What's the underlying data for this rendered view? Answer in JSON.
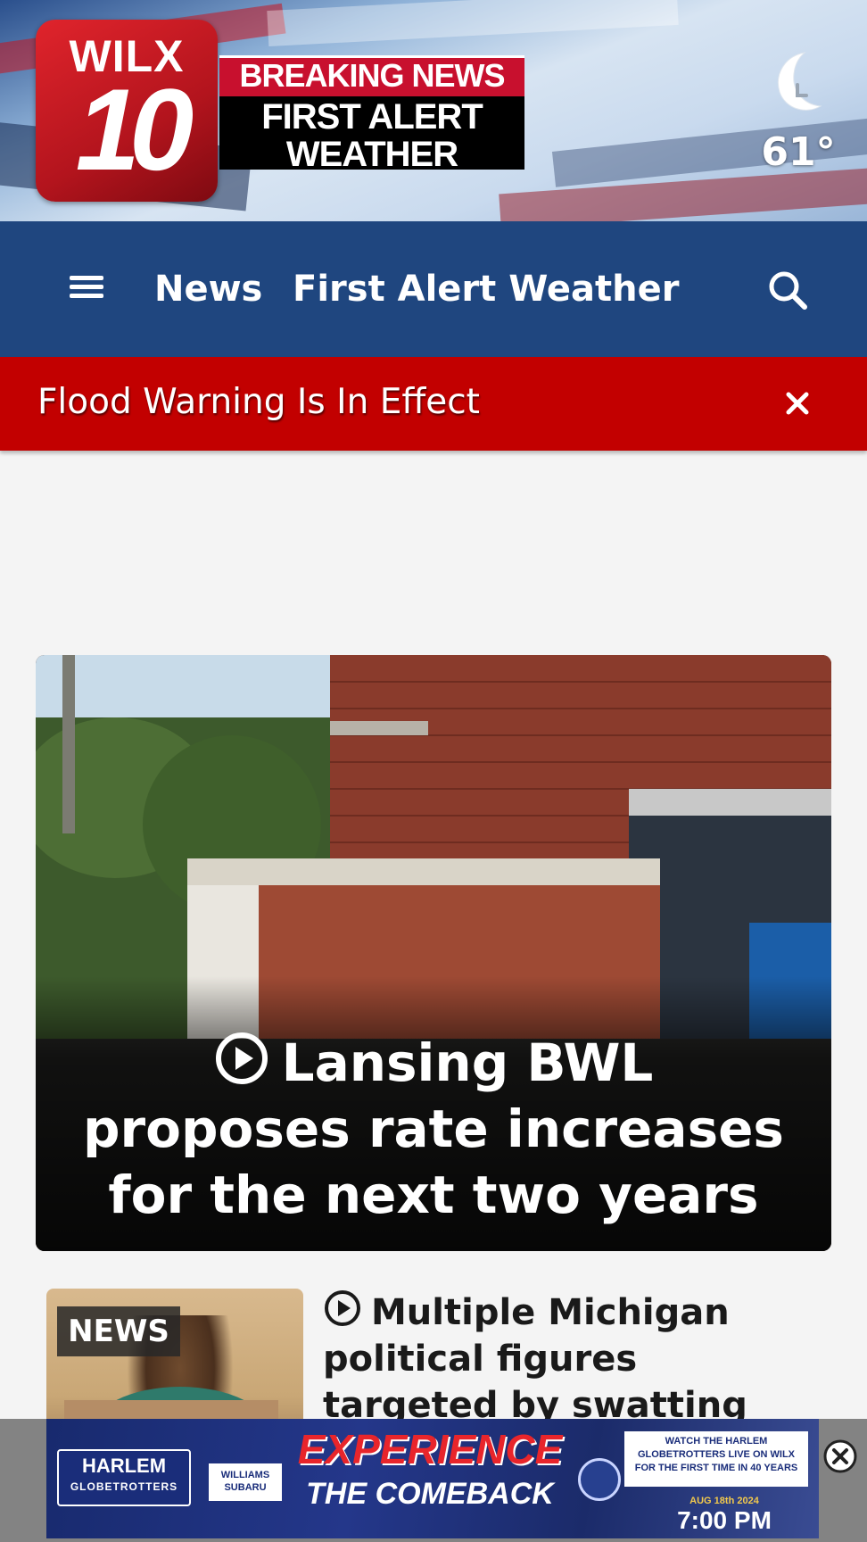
{
  "header": {
    "logo_call": "WILX",
    "logo_number": "10",
    "breaking_label": "BREAKING NEWS",
    "brand_label_line1": "FIRST ALERT",
    "brand_label_line2": "WEATHER",
    "weather_icon": "moon-icon",
    "temperature": "61°"
  },
  "nav": {
    "menu_icon": "hamburger-icon",
    "links": [
      "News",
      "First Alert Weather"
    ],
    "search_icon": "search-icon"
  },
  "alert": {
    "text": "Flood Warning Is In Effect",
    "close_icon": "close-icon"
  },
  "hero": {
    "title": "Lansing BWL proposes rate increases for the next two years",
    "play_icon": "play-circle-icon"
  },
  "stories": [
    {
      "badge": "NEWS",
      "title": "Multiple Michigan political figures targeted by swatting calls",
      "play_icon": "play-circle-icon"
    }
  ],
  "ad": {
    "logo_line1": "HARLEM",
    "logo_line2": "GLOBETROTTERS",
    "sponsor": "WILLIAMS SUBARU",
    "headline1": "EXPERIENCE",
    "headline2": "THE COMEBACK",
    "promo": "WATCH THE HARLEM GLOBETROTTERS LIVE ON WILX FOR THE FIRST TIME IN 40 YEARS",
    "date": "AUG 18th 2024",
    "time": "7:00 PM",
    "close_icon": "close-circle-icon"
  },
  "colors": {
    "nav_blue": "#1f467f",
    "alert_red": "#c20000",
    "brand_red": "#c8102e"
  }
}
